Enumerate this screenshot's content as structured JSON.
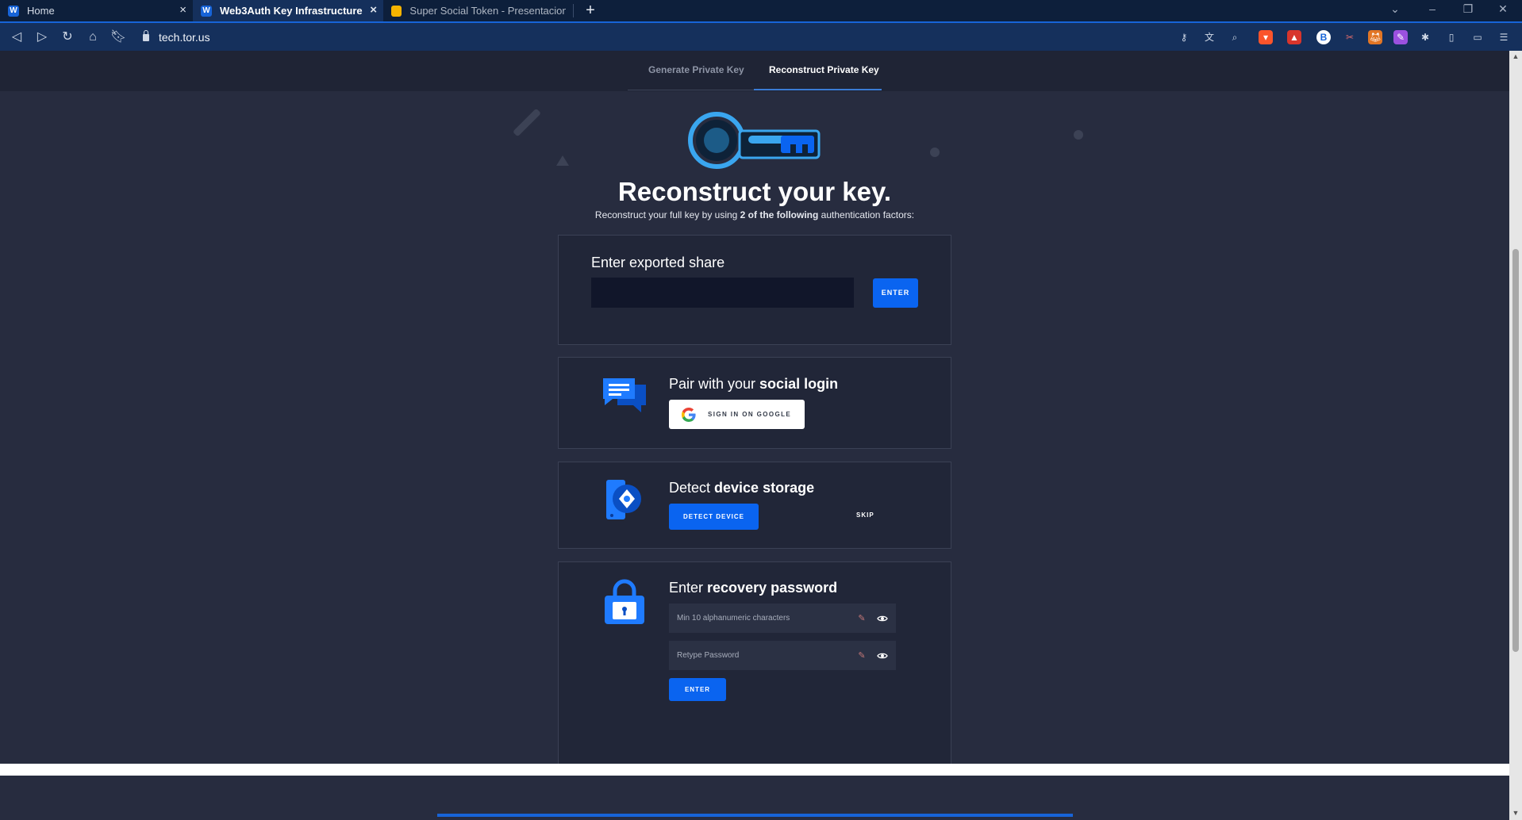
{
  "browser": {
    "tabs": [
      {
        "title": "Home"
      },
      {
        "title": "Web3Auth Key Infrastructure"
      },
      {
        "title": "Super Social Token - Presentaciones d"
      }
    ],
    "new_tab": "+",
    "favicon_letter": "W",
    "url": "tech.tor.us"
  },
  "page_tabs": {
    "generate": "Generate Private Key",
    "reconstruct": "Reconstruct Private Key"
  },
  "hero": {
    "title": "Reconstruct your key.",
    "subtitle_pre": "Reconstruct your full key by using ",
    "subtitle_bold": "2 of the following",
    "subtitle_post": " authentication factors:"
  },
  "share": {
    "title": "Enter exported share",
    "input_value": "",
    "enter_label": "ENTER"
  },
  "social": {
    "title_pre": "Pair with your ",
    "title_bold": "social login",
    "google_label": "SIGN IN ON GOOGLE"
  },
  "device": {
    "title_pre": "Detect ",
    "title_bold": "device storage",
    "detect_label": "DETECT DEVICE",
    "skip_label": "SKIP"
  },
  "password": {
    "title_pre": "Enter ",
    "title_bold": "recovery password",
    "field1_placeholder": "Min 10 alphanumeric characters",
    "field2_placeholder": "Retype Password",
    "enter_label": "ENTER"
  },
  "colors": {
    "accent": "#0a64f0",
    "background": "#272c3f",
    "card": "#212638",
    "browser_chrome": "#15305c"
  }
}
